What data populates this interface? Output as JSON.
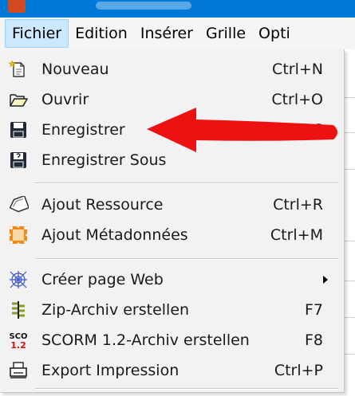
{
  "menubar": {
    "items": [
      {
        "label": "Fichier",
        "active": true
      },
      {
        "label": "Edition"
      },
      {
        "label": "Insérer"
      },
      {
        "label": "Grille"
      },
      {
        "label": "Opti"
      }
    ]
  },
  "dropdown": {
    "items": [
      {
        "label": "Nouveau",
        "shortcut": "Ctrl+N",
        "icon": "new-document-icon"
      },
      {
        "label": "Ouvrir",
        "shortcut": "Ctrl+O",
        "icon": "open-folder-icon"
      },
      {
        "label": "Enregistrer",
        "shortcut": "Ctrl+S",
        "icon": "save-disk-icon"
      },
      {
        "label": "Enregistrer Sous",
        "shortcut": "",
        "icon": "save-as-disk-icon"
      },
      {
        "label": "Ajout Ressource",
        "shortcut": "Ctrl+R",
        "icon": "resource-tag-icon"
      },
      {
        "label": "Ajout Métadonnées",
        "shortcut": "Ctrl+M",
        "icon": "metadata-frame-icon"
      },
      {
        "label": "Créer page Web",
        "shortcut": "",
        "icon": "web-page-icon",
        "submenu": true
      },
      {
        "label": "Zip-Archiv erstellen",
        "shortcut": "F7",
        "icon": "zip-archive-icon"
      },
      {
        "label": "SCORM 1.2-Archiv erstellen",
        "shortcut": "F8",
        "icon": "scorm-icon"
      },
      {
        "label": "Export Impression",
        "shortcut": "Ctrl+P",
        "icon": "print-export-icon"
      }
    ]
  },
  "icons": {
    "scorm_top": "SCO",
    "scorm_bottom": "1.2"
  },
  "colors": {
    "titlebar": "#0078d7",
    "menu_active_bg": "#cce8ff",
    "menu_bg": "#f2f2f2",
    "annotation_arrow": "#ee1111"
  }
}
